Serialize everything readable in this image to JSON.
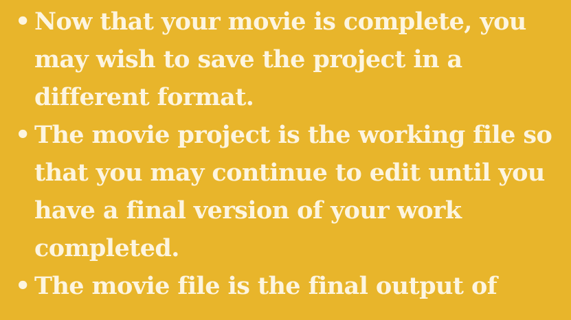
{
  "slide": {
    "background_color": "#e8b52b",
    "text_color": "#fdf5e0",
    "bullet_glyph": "•",
    "bullets": [
      {
        "text": "Now that your movie is complete, you may wish to save the project in a different format."
      },
      {
        "text": "The movie project is the working file so that you may continue to edit until you have a final version of your work completed."
      },
      {
        "text": "The movie file is the final output of"
      }
    ]
  }
}
